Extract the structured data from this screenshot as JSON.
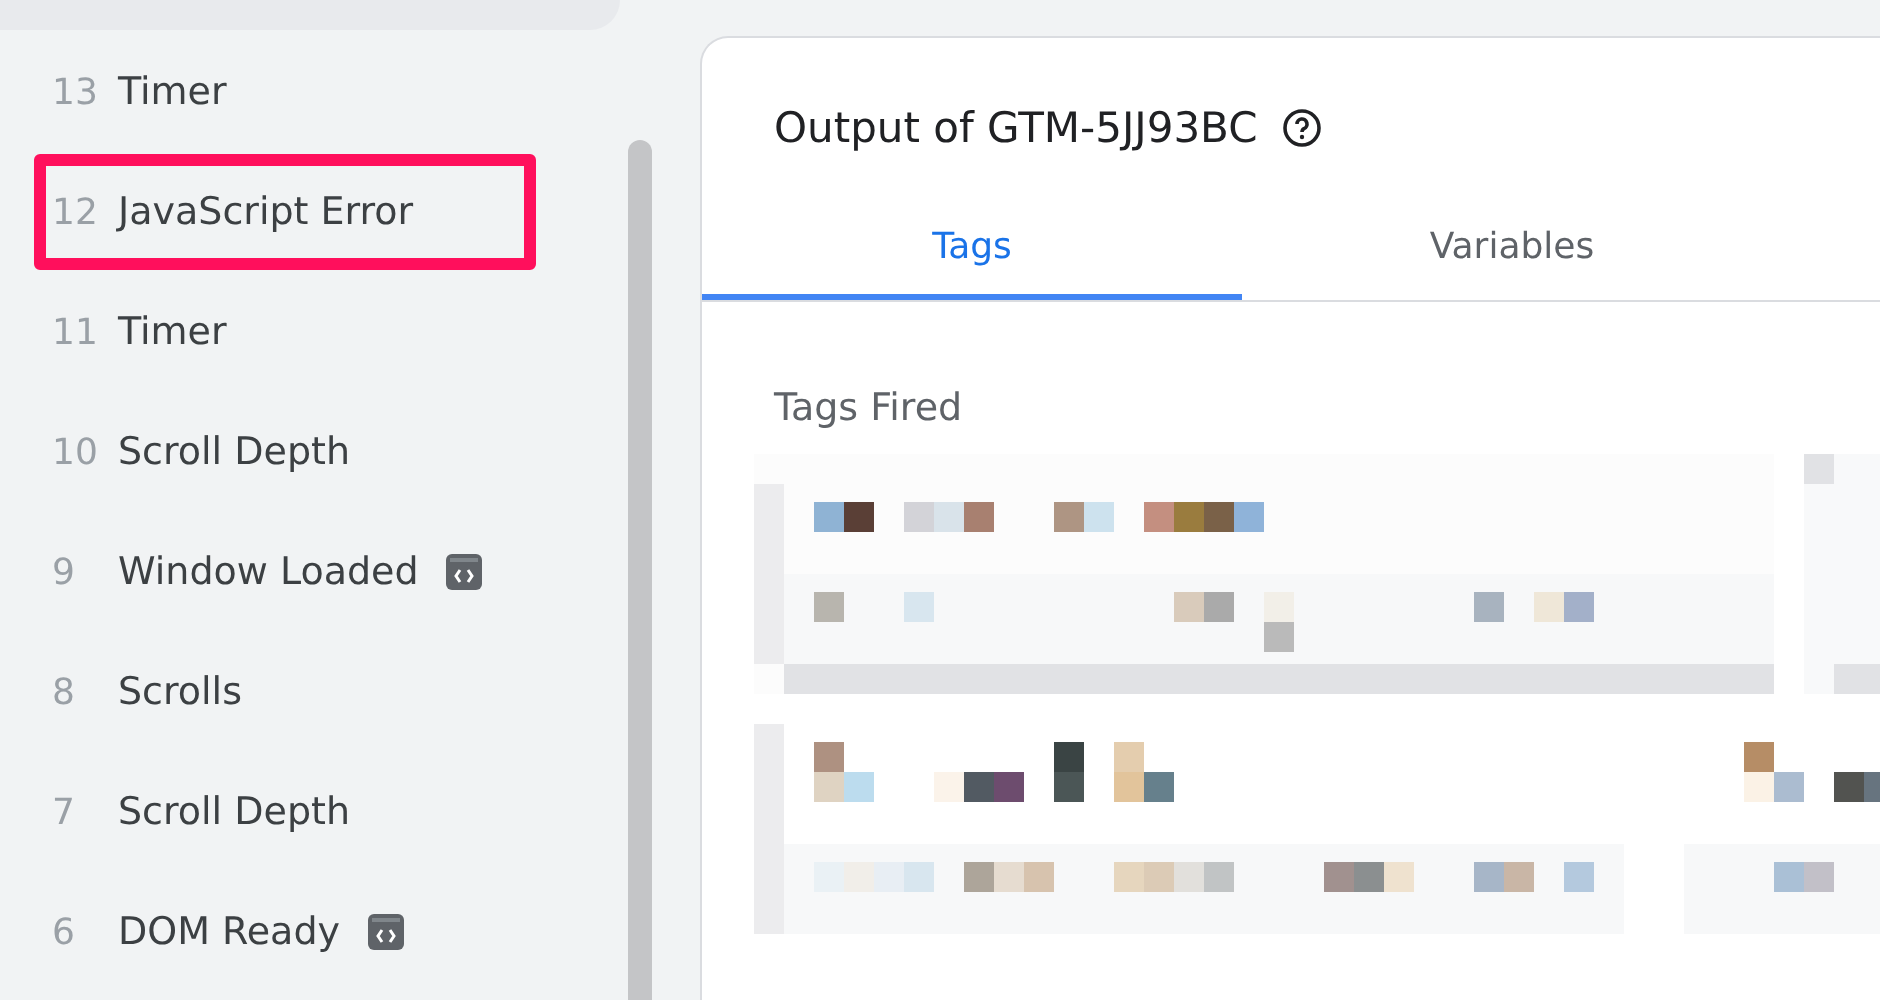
{
  "sidebar": {
    "items": [
      {
        "number": "13",
        "label": "Timer",
        "code_icon": false,
        "highlighted": false
      },
      {
        "number": "12",
        "label": "JavaScript Error",
        "code_icon": false,
        "highlighted": true
      },
      {
        "number": "11",
        "label": "Timer",
        "code_icon": false,
        "highlighted": false
      },
      {
        "number": "10",
        "label": "Scroll Depth",
        "code_icon": false,
        "highlighted": false
      },
      {
        "number": "9",
        "label": "Window Loaded",
        "code_icon": true,
        "highlighted": false
      },
      {
        "number": "8",
        "label": "Scrolls",
        "code_icon": false,
        "highlighted": false
      },
      {
        "number": "7",
        "label": "Scroll Depth",
        "code_icon": false,
        "highlighted": false
      },
      {
        "number": "6",
        "label": "DOM Ready",
        "code_icon": true,
        "highlighted": false
      }
    ]
  },
  "output": {
    "title": "Output of GTM-5JJ93BC",
    "tabs": [
      {
        "label": "Tags",
        "selected": true
      },
      {
        "label": "Variables",
        "selected": false
      }
    ],
    "section_title": "Tags Fired"
  }
}
